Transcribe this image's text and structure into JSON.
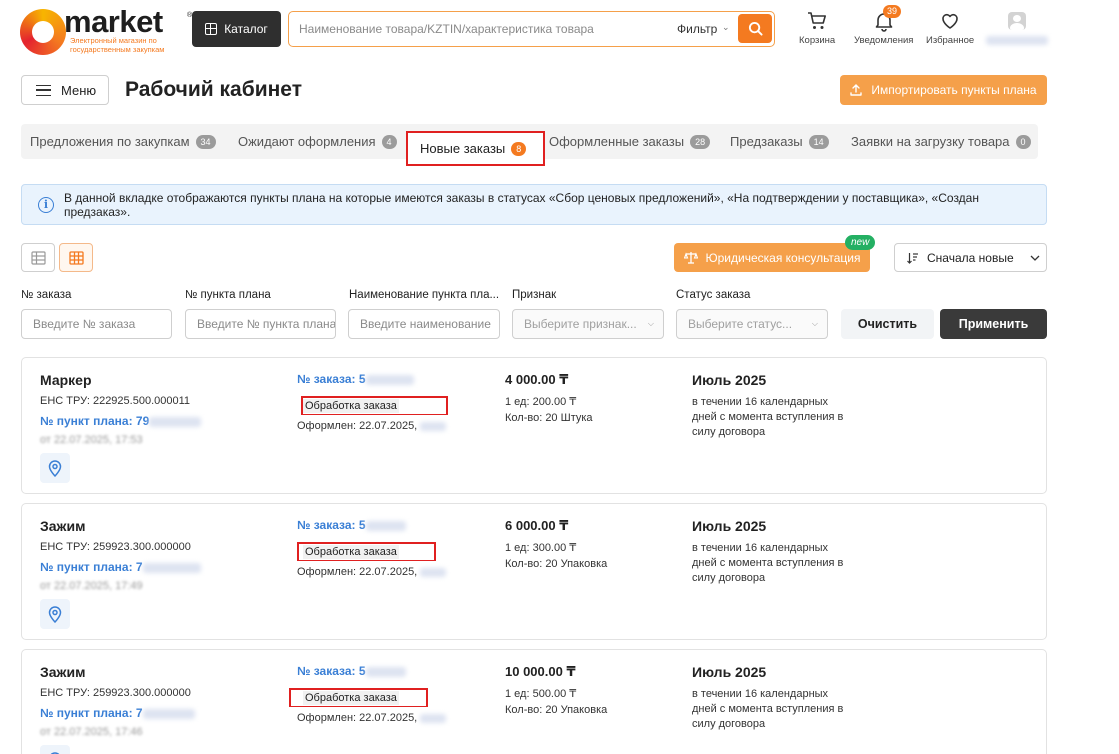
{
  "header": {
    "logo_text": "market",
    "logo_reg": "®",
    "logo_sub": "Электронный магазин по государственным закупкам",
    "catalog_label": "Каталог",
    "search_placeholder": "Наименование товара/KZTIN/характеристика товара",
    "filter_label": "Фильтр",
    "cart_label": "Корзина",
    "notifications_label": "Уведомления",
    "notifications_count": "39",
    "favorites_label": "Избранное"
  },
  "page": {
    "menu_label": "Меню",
    "title": "Рабочий кабинет",
    "import_label": "Импортировать пункты плана"
  },
  "tabs": [
    {
      "label": "Предложения по закупкам",
      "count": "34"
    },
    {
      "label": "Ожидают оформления",
      "count": "4"
    },
    {
      "label": "Новые заказы",
      "count": "8"
    },
    {
      "label": "Оформленные заказы",
      "count": "28"
    },
    {
      "label": "Предзаказы",
      "count": "14"
    },
    {
      "label": "Заявки на загрузку товара",
      "count": "0"
    }
  ],
  "info_text": "В данной вкладке отображаются пункты плана на которые имеются заказы в статусах «Сбор ценовых предложений», «На подтверждении у поставщика», «Создан предзаказ».",
  "toolbar": {
    "legal_label": "Юридическая консультация",
    "new_badge": "new",
    "sort_label": "Сначала новые"
  },
  "filters": {
    "order_no": {
      "label": "№ заказа",
      "placeholder": "Введите № заказа"
    },
    "plan_no": {
      "label": "№ пункта плана",
      "placeholder": "Введите № пункта плана"
    },
    "plan_name": {
      "label": "Наименование пункта пла...",
      "placeholder": "Введите наименование"
    },
    "sign": {
      "label": "Признак",
      "placeholder": "Выберите признак..."
    },
    "status": {
      "label": "Статус заказа",
      "placeholder": "Выберите статус..."
    },
    "clear_label": "Очистить",
    "apply_label": "Применить"
  },
  "orders": [
    {
      "name": "Маркер",
      "enst": "ЕНС ТРУ: 222925.500.000011",
      "plan_prefix": "№ пункт плана: 79",
      "date": "от 22.07.2025, 17:53",
      "order_prefix": "№ заказа: 5",
      "status": "Обработка заказа",
      "formed": "Оформлен: 22.07.2025,",
      "price": "4 000.00 ₸",
      "unit": "1 ед: 200.00 ₸",
      "qty": "Кол-во: 20 Штука",
      "month": "Июль 2025",
      "term": "в течении 16 календарных дней с момента вступления в силу договора"
    },
    {
      "name": "Зажим",
      "enst": "ЕНС ТРУ: 259923.300.000000",
      "plan_prefix": "№ пункт плана: 7",
      "date": "от 22.07.2025, 17:49",
      "order_prefix": "№ заказа: 5",
      "status": "Обработка заказа",
      "formed": "Оформлен: 22.07.2025,",
      "price": "6 000.00 ₸",
      "unit": "1 ед: 300.00 ₸",
      "qty": "Кол-во: 20 Упаковка",
      "month": "Июль 2025",
      "term": "в течении 16 календарных дней с момента вступления в силу договора"
    },
    {
      "name": "Зажим",
      "enst": "ЕНС ТРУ: 259923.300.000000",
      "plan_prefix": "№ пункт плана: 7",
      "date": "от 22.07.2025, 17:46",
      "order_prefix": "№ заказа: 5",
      "status": "Обработка заказа",
      "formed": "Оформлен: 22.07.2025,",
      "price": "10 000.00 ₸",
      "unit": "1 ед: 500.00 ₸",
      "qty": "Кол-во: 20 Упаковка",
      "month": "Июль 2025",
      "term": "в течении 16 календарных дней с момента вступления в силу договора"
    }
  ],
  "colors": {
    "accent": "#f47a20",
    "accent_light": "#f5a04a",
    "link": "#3a7fd5",
    "highlight": "#e02020"
  },
  "icons": [
    "grid-icon",
    "search-icon",
    "cart-icon",
    "bell-icon",
    "heart-icon",
    "avatar-icon",
    "upload-icon",
    "info-icon",
    "table-view-icon",
    "card-view-icon",
    "scales-icon",
    "sort-icon",
    "chevron-down-icon",
    "map-pin-icon"
  ]
}
